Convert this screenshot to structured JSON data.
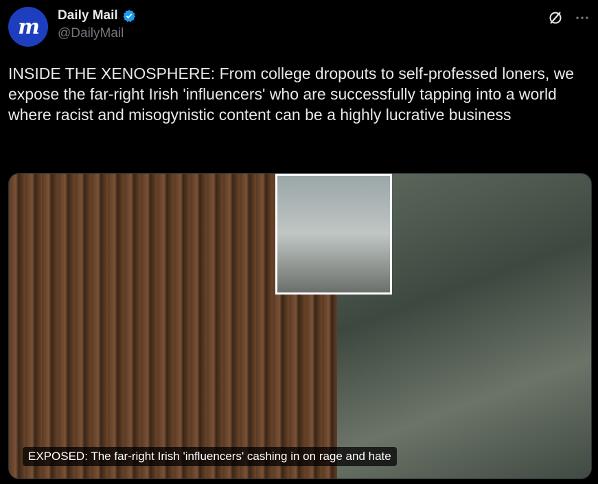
{
  "account": {
    "avatar_text": "m",
    "display_name": "Daily Mail",
    "handle": "@DailyMail",
    "verified": true
  },
  "tweet": {
    "text": "INSIDE THE XENOSPHERE: From college dropouts to self-professed loners, we expose the far-right Irish 'influencers' who are successfully tapping into a world where racist and misogynistic content can be a highly lucrative business"
  },
  "media": {
    "caption": "EXPOSED: The far-right Irish 'influencers' cashing in on rage and hate"
  },
  "icons": [
    "verified-badge-icon",
    "grok-icon",
    "more-icon"
  ],
  "colors": {
    "background": "#000000",
    "text": "#e7e9ea",
    "muted": "#71767b",
    "verified": "#1d9bf0"
  }
}
